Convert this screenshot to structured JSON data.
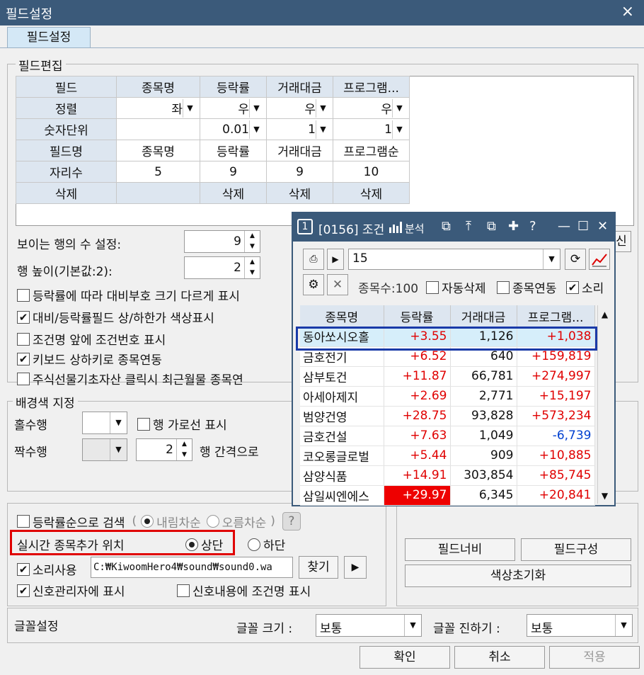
{
  "window": {
    "title": "필드설정",
    "close": "×",
    "tab": "필드설정"
  },
  "field_edit": {
    "group_label": "필드편집",
    "row_labels": [
      "필드",
      "정렬",
      "숫자단위",
      "필드명",
      "자리수",
      "삭제"
    ],
    "columns": [
      {
        "field": "종목명",
        "align": "좌",
        "unit": "",
        "name": "종목명",
        "digits": "5",
        "delete": ""
      },
      {
        "field": "등락률",
        "align": "우",
        "unit": "0.01",
        "name": "등락률",
        "digits": "9",
        "delete": "삭제"
      },
      {
        "field": "거래대금",
        "align": "우",
        "unit": "1",
        "name": "거래대금",
        "digits": "9",
        "delete": "삭제"
      },
      {
        "field": "프로그램...",
        "align": "우",
        "unit": "1",
        "name": "프로그램순",
        "digits": "10",
        "delete": "삭제"
      }
    ]
  },
  "visible_rows": {
    "label": "보이는 행의 수 설정:",
    "value": "9"
  },
  "row_height": {
    "label": "행 높이(기본값:2):",
    "value": "2"
  },
  "options": [
    {
      "label": "등락률에 따라 대비부호 크기 다르게 표시",
      "checked": false
    },
    {
      "label": "대비/등락률필드 상/하한가 색상표시",
      "checked": true
    },
    {
      "label": "조건명 앞에 조건번호 표시",
      "checked": false
    },
    {
      "label": "키보드 상하키로 종목연동",
      "checked": true
    },
    {
      "label": "주식선물기초자산 클릭시 최근월물 종목연",
      "checked": false
    }
  ],
  "partial_button": "신",
  "bg": {
    "group_label": "배경색 지정",
    "odd_label": "홀수행",
    "even_label": "짝수행",
    "hline_label": "행 가로선 표시",
    "interval_value": "2",
    "interval_label": "행 간격으로"
  },
  "search": {
    "label": "등락률순으로 검색",
    "paren_open": "(",
    "desc": "내림차순",
    "asc": "오름차순",
    "paren_close": ")",
    "help": "?"
  },
  "realtime": {
    "label": "실시간 종목추가 위치",
    "top": "상단",
    "bottom": "하단"
  },
  "sound": {
    "label": "소리사용",
    "path": "C:₩KiwoomHero4₩sound₩sound0.wa",
    "find": "찾기",
    "play": "▶"
  },
  "signal": {
    "mgr": "신호관리자에 표시",
    "cond": "신호내용에 조건명 표시"
  },
  "buttons": {
    "field_width": "필드너비",
    "field_config": "필드구성",
    "color_reset": "색상초기화"
  },
  "font": {
    "group_label": "글꼴설정",
    "size_label": "글꼴 크기 :",
    "size_value": "보통",
    "dark_label": "글꼴 진하기 :",
    "dark_value": "보통"
  },
  "footer": {
    "ok": "확인",
    "cancel": "취소",
    "apply": "적용"
  },
  "popup": {
    "num": "1",
    "title": "[0156] 조건",
    "analysis": "분석",
    "help": "?",
    "condition": "15",
    "count_label": "종목수:100",
    "auto_delete": "자동삭제",
    "link": "종목연동",
    "sound": "소리",
    "headers": [
      "종목명",
      "등락률",
      "거래대금",
      "프로그램..."
    ],
    "rows": [
      {
        "name": "동아쏘시오홀",
        "rate": "+3.55",
        "amount": "1,126",
        "prog": "+1,038",
        "prog_color": "red",
        "hl": true
      },
      {
        "name": "금호전기",
        "rate": "+6.52",
        "amount": "640",
        "prog": "+159,819",
        "prog_color": "red"
      },
      {
        "name": "삼부토건",
        "rate": "+11.87",
        "amount": "66,781",
        "prog": "+274,997",
        "prog_color": "red"
      },
      {
        "name": "아세아제지",
        "rate": "+2.69",
        "amount": "2,771",
        "prog": "+15,197",
        "prog_color": "red"
      },
      {
        "name": "범양건영",
        "rate": "+28.75",
        "amount": "93,828",
        "prog": "+573,234",
        "prog_color": "red"
      },
      {
        "name": "금호건설",
        "rate": "+7.63",
        "amount": "1,049",
        "prog": "-6,739",
        "prog_color": "blue"
      },
      {
        "name": "코오롱글로벌",
        "rate": "+5.44",
        "amount": "909",
        "prog": "+10,885",
        "prog_color": "red"
      },
      {
        "name": "삼양식품",
        "rate": "+14.91",
        "amount": "303,854",
        "prog": "+85,745",
        "prog_color": "red"
      },
      {
        "name": "삼일씨엔에스",
        "rate": "+29.97",
        "amount": "6,345",
        "prog": "+20,841",
        "prog_color": "red",
        "upper": true
      }
    ]
  },
  "colors": {
    "title_bar": "#3b5a7a",
    "highlight_blue": "#1a3aa8",
    "highlight_red": "#e00000",
    "upper_limit_bg": "#ee0000"
  }
}
